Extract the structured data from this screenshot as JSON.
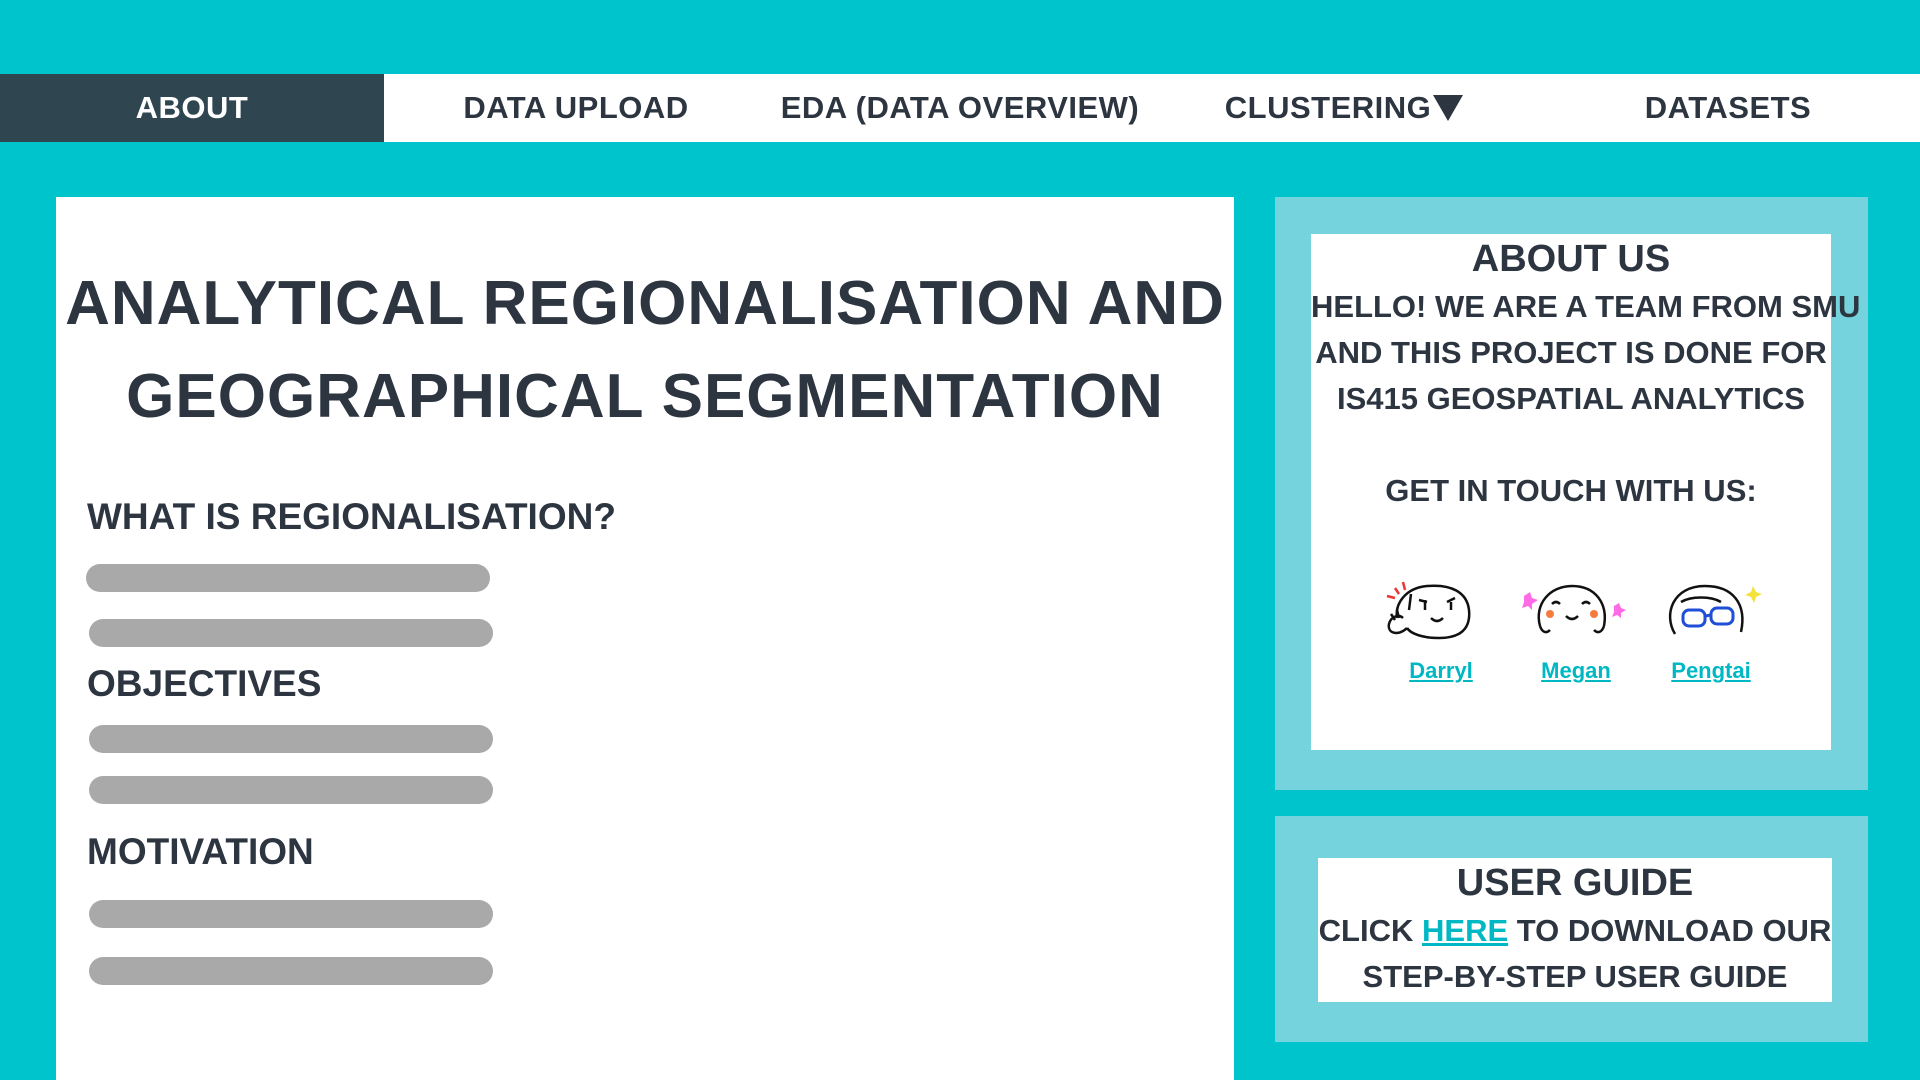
{
  "nav": {
    "items": [
      {
        "label": "ABOUT",
        "active": true
      },
      {
        "label": "DATA UPLOAD"
      },
      {
        "label": "EDA (DATA OVERVIEW)"
      },
      {
        "label": "CLUSTERING",
        "icon": "dropdown-triangle-icon"
      },
      {
        "label": "DATASETS"
      }
    ]
  },
  "main": {
    "title_line1": "ANALYTICAL REGIONALISATION AND",
    "title_line2": "GEOGRAPHICAL SEGMENTATION",
    "sections": [
      {
        "heading": "WHAT IS REGIONALISATION?"
      },
      {
        "heading": "OBJECTIVES"
      },
      {
        "heading": "MOTIVATION"
      }
    ]
  },
  "about_us": {
    "title": "ABOUT US",
    "lines": [
      "HELLO! WE ARE A TEAM FROM SMU",
      "AND THIS PROJECT IS DONE FOR",
      "IS415 GEOSPATIAL ANALYTICS"
    ],
    "contact_heading": "GET IN TOUCH WITH US:",
    "members": [
      {
        "name": "Darryl ",
        "icon": "darryl-avatar-icon"
      },
      {
        "name": "Megan",
        "icon": "megan-avatar-icon"
      },
      {
        "name": "Pengtai",
        "icon": "pengtai-avatar-icon"
      }
    ]
  },
  "user_guide": {
    "title": "USER GUIDE",
    "text_before": "CLICK ",
    "link": "HERE",
    "text_after": " TO DOWNLOAD OUR",
    "line2": "STEP-BY-STEP USER GUIDE"
  },
  "colors": {
    "background": "#00c4cc",
    "nav_active": "#2f4550",
    "side_box": "#74d3dc",
    "text": "#2c3540",
    "link": "#00b8c4",
    "placeholder": "#a9a9a9"
  }
}
